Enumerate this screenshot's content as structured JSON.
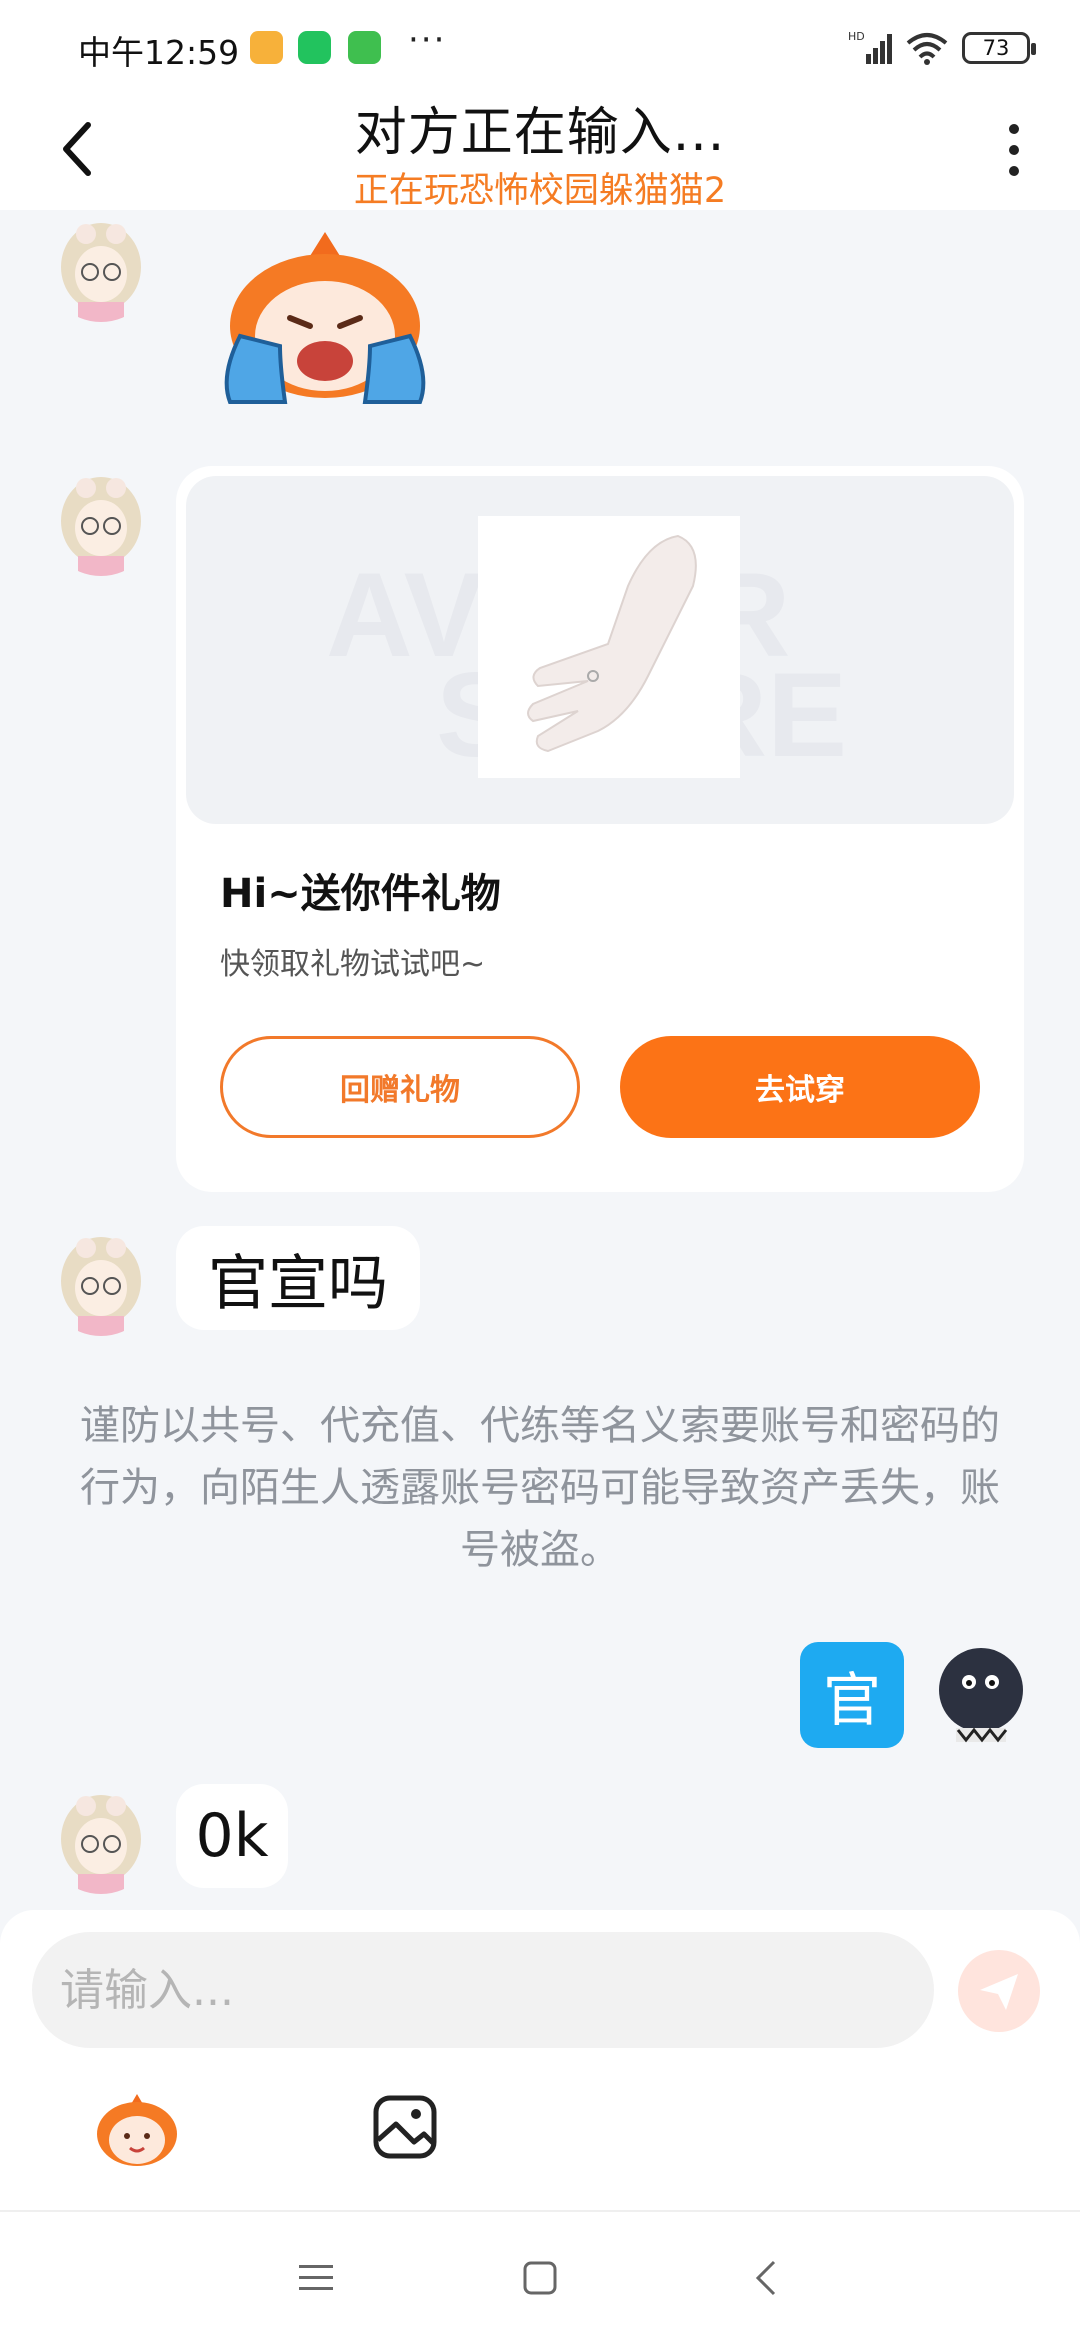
{
  "status_bar": {
    "time": "中午12:59",
    "more": "···",
    "network": "HD",
    "battery": "73"
  },
  "header": {
    "title": "对方正在输入...",
    "subtitle": "正在玩恐怖校园躲猫猫2",
    "back_icon": "chevron-left-icon",
    "more_icon": "more-vertical-icon"
  },
  "messages": [
    {
      "side": "left",
      "type": "sticker",
      "content": "crying-cartoon-sticker"
    },
    {
      "side": "left",
      "type": "gift",
      "gift": {
        "watermark_1": "AVATAR",
        "watermark_2": "STORE",
        "title": "Hi~送你件礼物",
        "subtitle": "快领取礼物试试吧~",
        "return_label": "回赠礼物",
        "try_label": "去试穿"
      }
    },
    {
      "side": "left",
      "type": "text",
      "text": "官宣吗"
    },
    {
      "side": "right",
      "type": "sticker",
      "text": "官"
    },
    {
      "side": "left",
      "type": "text",
      "text": "0k"
    }
  ],
  "notice": "谨防以共号、代充值、代练等名义索要账号和密码的行为，向陌生人透露账号密码可能导致资产丢失，账号被盗。",
  "input": {
    "placeholder": "请输入...",
    "send_icon": "send-icon",
    "tools": [
      "emoji-sticker-icon",
      "image-icon"
    ]
  },
  "colors": {
    "accent": "#fc7316",
    "subtitle": "#f57c23",
    "sticker_blue": "#1eaaf1",
    "background": "#f4f6f9"
  },
  "nav": [
    "menu-icon",
    "home-icon",
    "back-icon"
  ]
}
